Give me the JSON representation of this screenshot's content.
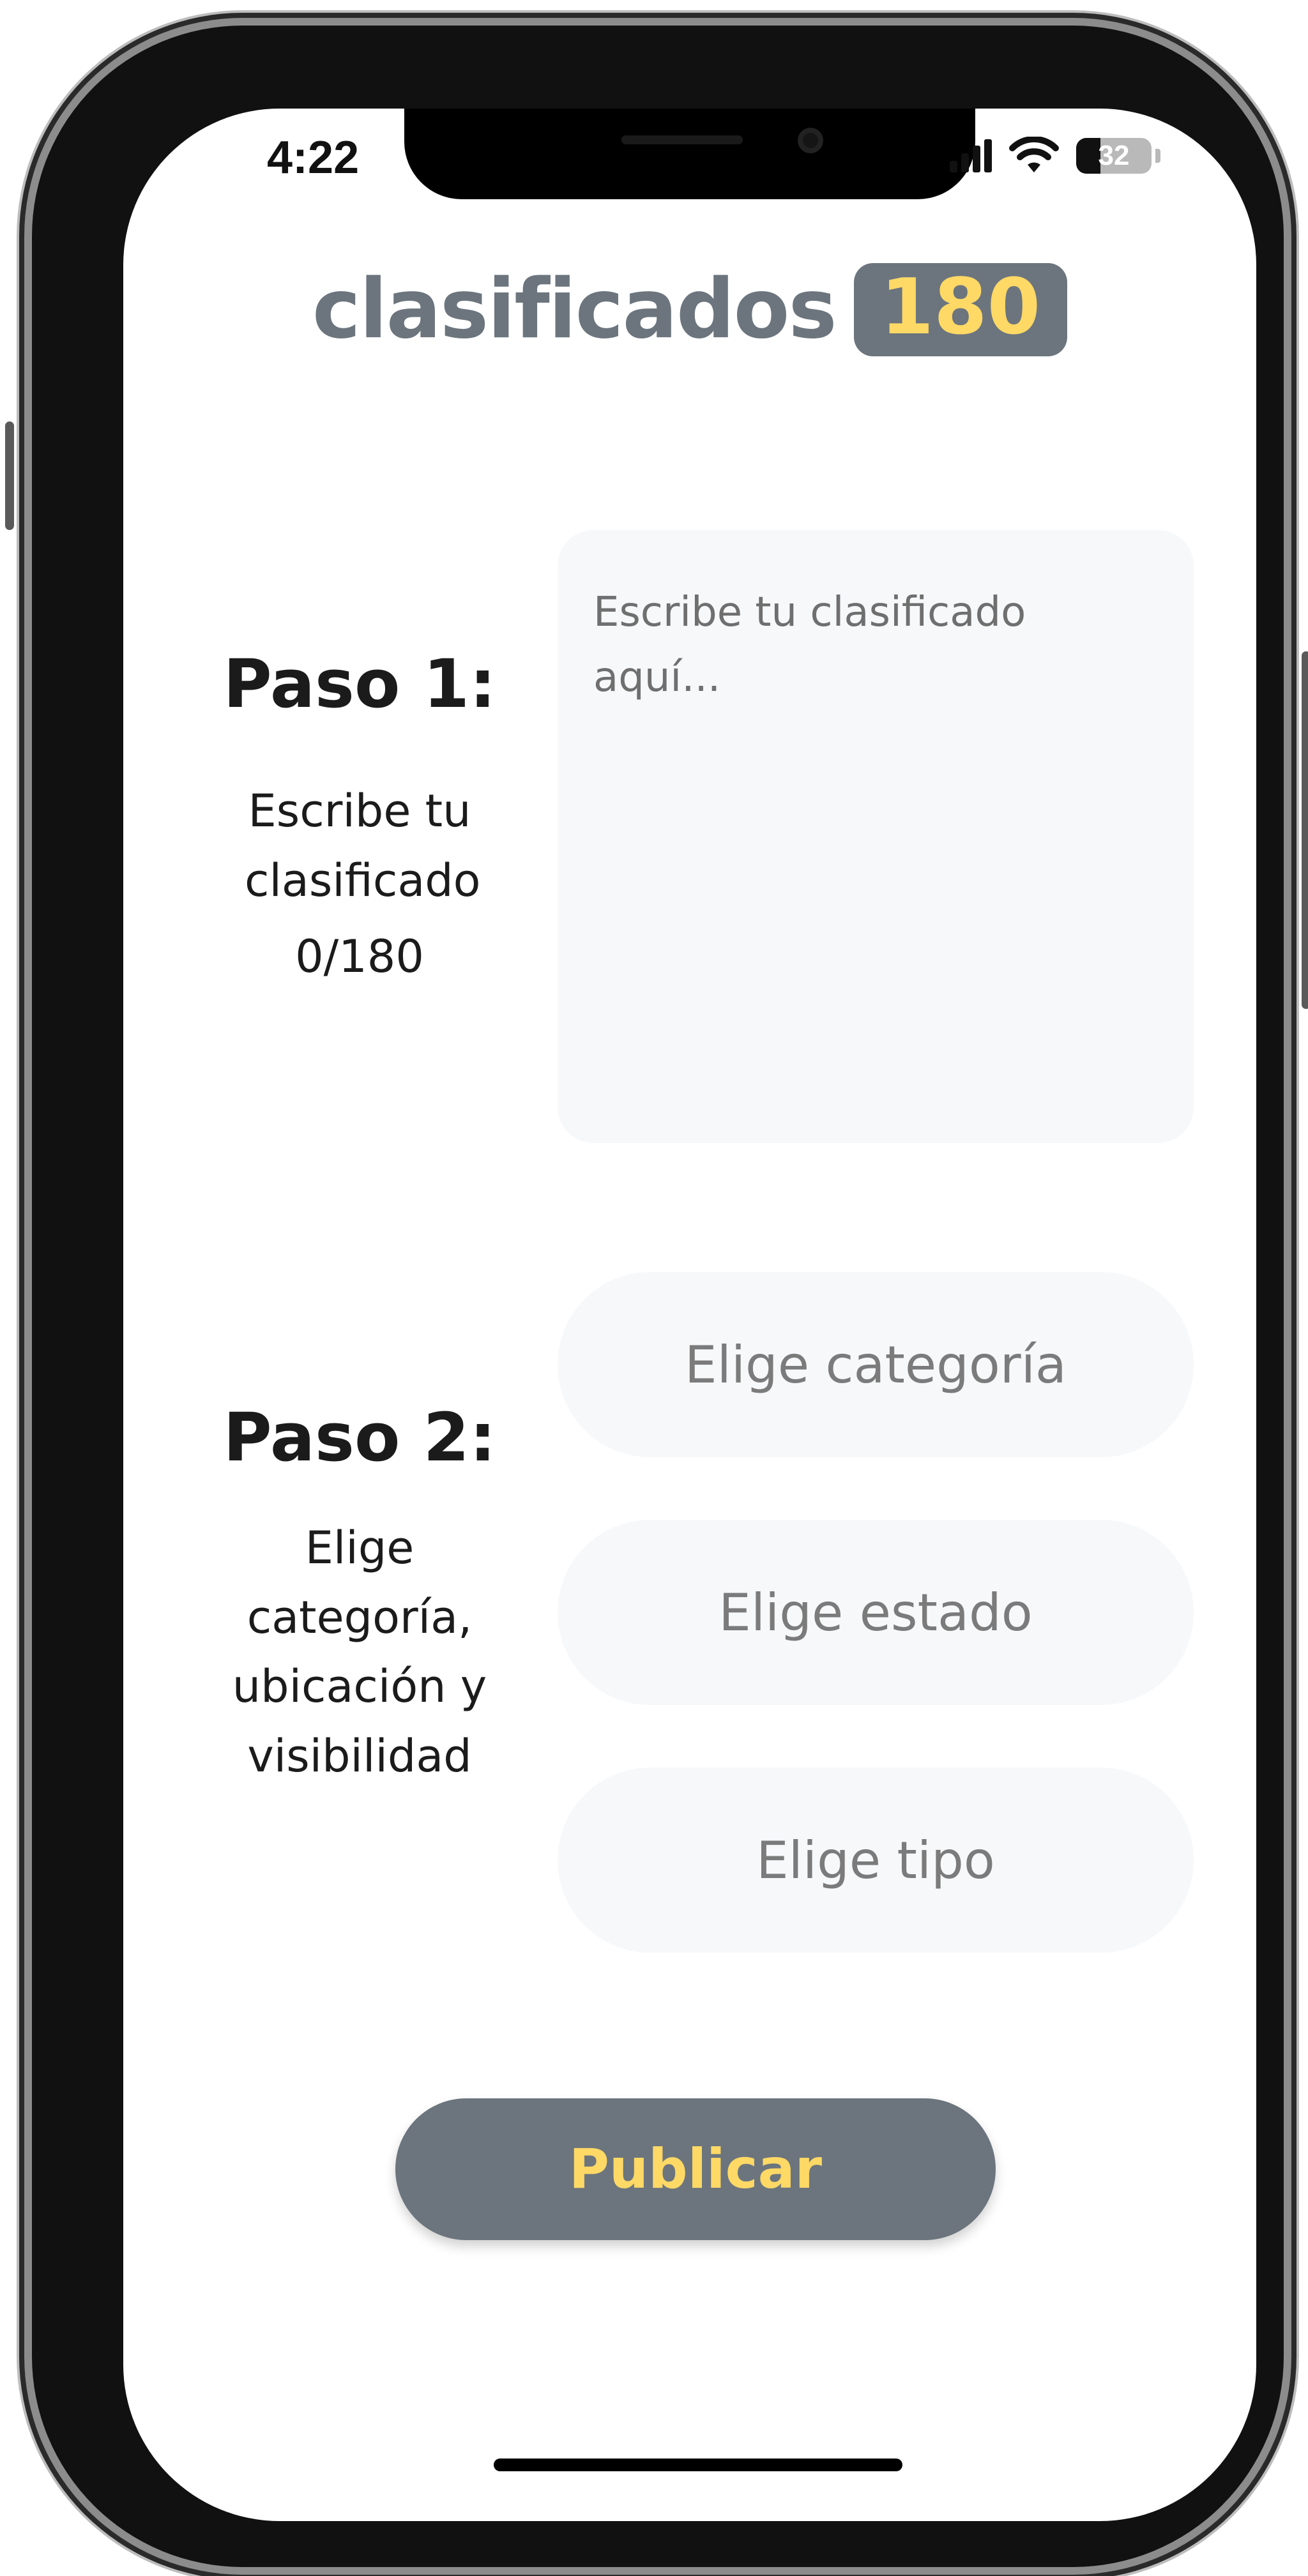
{
  "status_bar": {
    "time": "4:22",
    "battery_level": "32",
    "battery_fraction": 0.32,
    "wifi_icon": "wifi-icon",
    "signal_icon": "cellular-signal-icon"
  },
  "logo": {
    "text": "clasificados",
    "badge": "180",
    "text_color": "#6c757d",
    "badge_color": "#ffd966"
  },
  "step1": {
    "title": "Paso 1:",
    "description": "Escribe tu clasificado",
    "counter": "0/180",
    "textarea_placeholder": "Escribe tu clasificado aquí..."
  },
  "step2": {
    "title": "Paso 2:",
    "description": "Elige categoría, ubicación y visibilidad",
    "selects": {
      "category": "Elige categoría",
      "state": "Elige estado",
      "type": "Elige tipo"
    }
  },
  "actions": {
    "publish_label": "Publicar",
    "publish_bg": "#6c757d",
    "publish_text_color": "#ffd966"
  }
}
